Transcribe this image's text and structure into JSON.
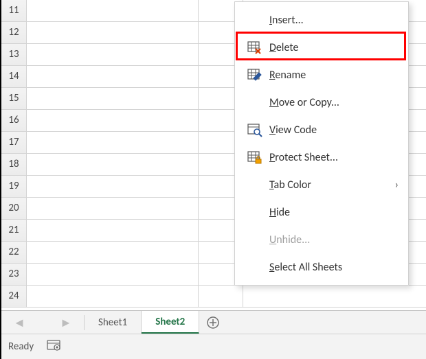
{
  "grid": {
    "row_start": 11,
    "row_end": 24
  },
  "sheetbar": {
    "tabs": [
      {
        "label": "Sheet1",
        "active": false
      },
      {
        "label": "Sheet2",
        "active": true
      }
    ],
    "nav_prev": "◄",
    "nav_next": "►"
  },
  "statusbar": {
    "state": "Ready"
  },
  "context_menu": {
    "items": [
      {
        "id": "insert",
        "label": "Insert...",
        "ukey": "I",
        "icon": "",
        "disabled": false,
        "arrow": false
      },
      {
        "id": "delete",
        "label": "Delete",
        "ukey": "D",
        "icon": "delete",
        "disabled": false,
        "arrow": false,
        "highlight": true
      },
      {
        "id": "rename",
        "label": "Rename",
        "ukey": "R",
        "icon": "rename",
        "disabled": false,
        "arrow": false
      },
      {
        "id": "move-copy",
        "label": "Move or Copy...",
        "ukey": "M",
        "icon": "",
        "disabled": false,
        "arrow": false
      },
      {
        "id": "view-code",
        "label": "View Code",
        "ukey": "V",
        "icon": "viewcode",
        "disabled": false,
        "arrow": false
      },
      {
        "id": "protect",
        "label": "Protect Sheet...",
        "ukey": "P",
        "icon": "protect",
        "disabled": false,
        "arrow": false
      },
      {
        "id": "tab-color",
        "label": "Tab Color",
        "ukey": "T",
        "icon": "",
        "disabled": false,
        "arrow": true
      },
      {
        "id": "hide",
        "label": "Hide",
        "ukey": "H",
        "icon": "",
        "disabled": false,
        "arrow": false
      },
      {
        "id": "unhide",
        "label": "Unhide...",
        "ukey": "U",
        "icon": "",
        "disabled": true,
        "arrow": false
      },
      {
        "id": "select-all",
        "label": "Select All Sheets",
        "ukey": "S",
        "icon": "",
        "disabled": false,
        "arrow": false
      }
    ],
    "arrow_glyph": "›"
  }
}
